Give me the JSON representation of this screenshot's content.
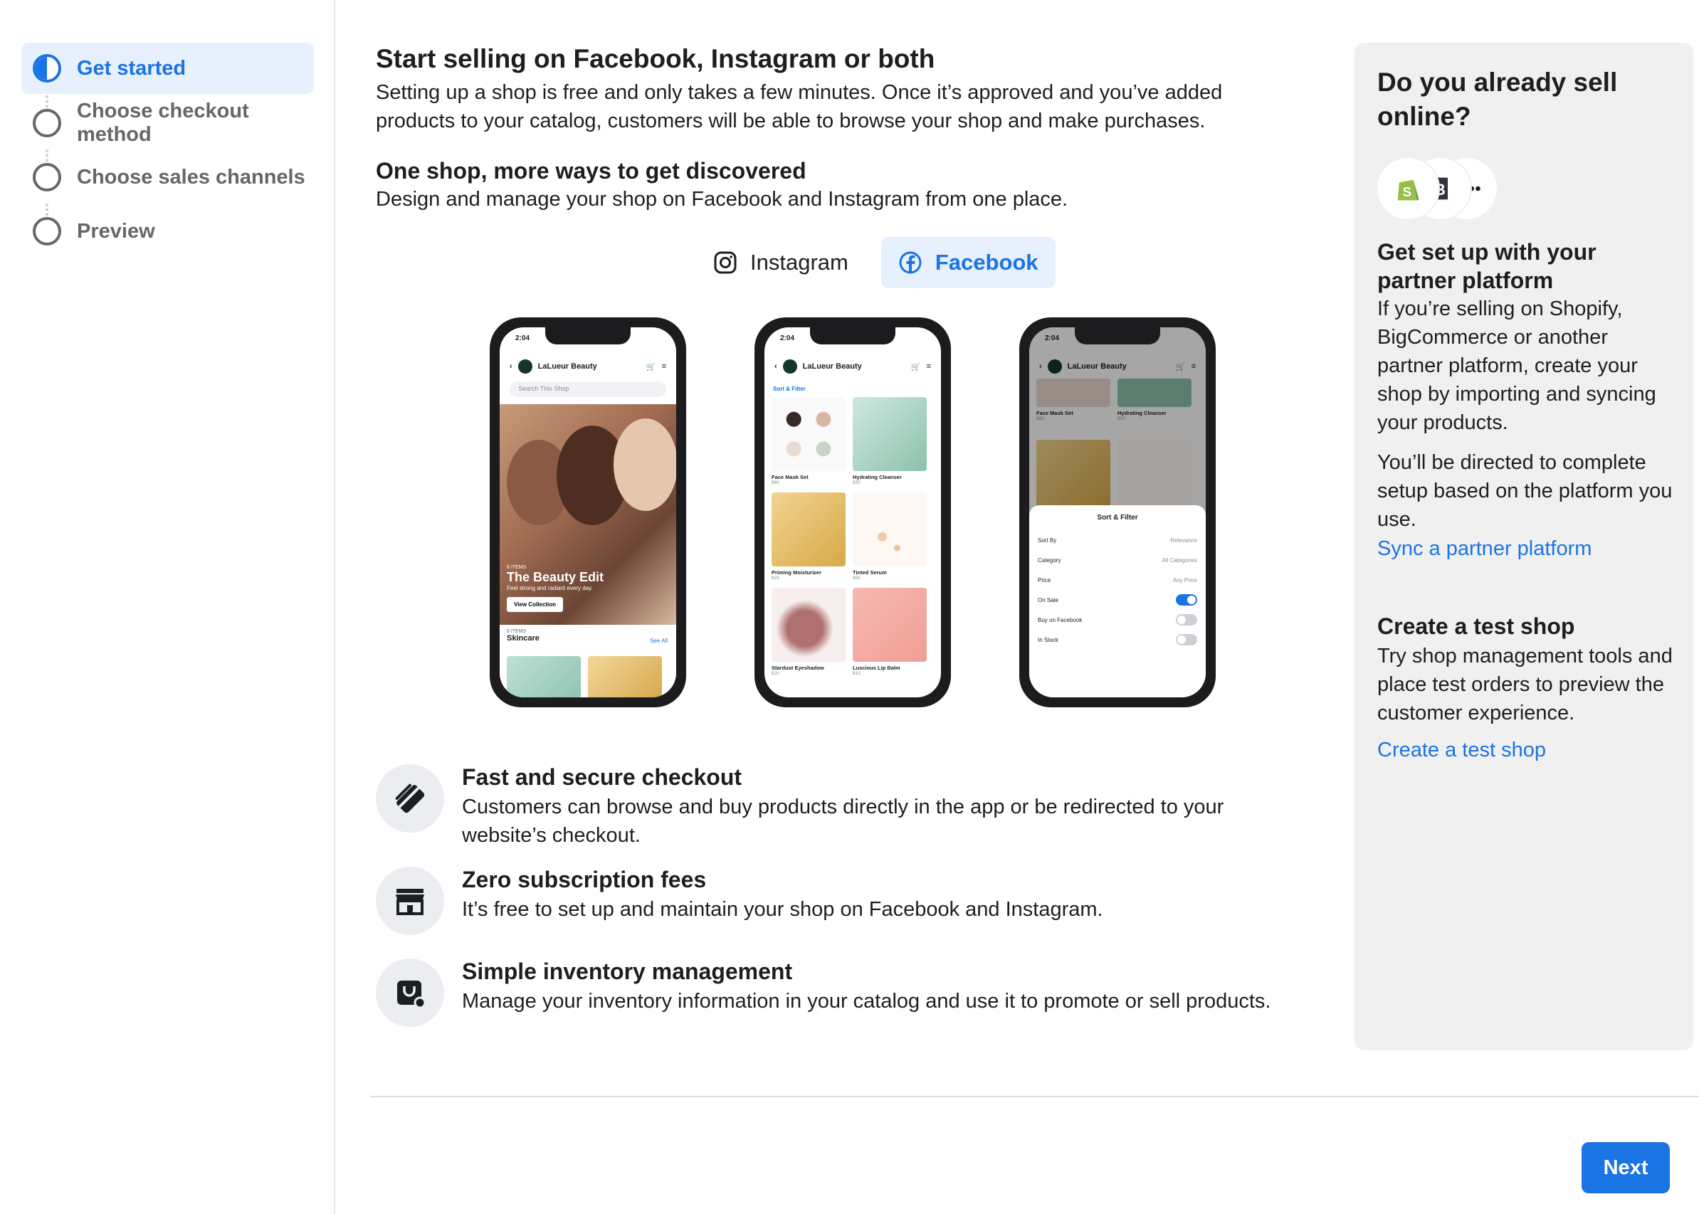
{
  "sidebar": {
    "steps": [
      {
        "label": "Get started",
        "active": true
      },
      {
        "label": "Choose checkout method",
        "active": false
      },
      {
        "label": "Choose sales channels",
        "active": false
      },
      {
        "label": "Preview",
        "active": false
      }
    ]
  },
  "main": {
    "title": "Start selling on Facebook, Instagram or both",
    "intro": "Setting up a shop is free and only takes a few minutes. Once it’s approved and you’ve added products to your catalog, customers will be able to browse your shop and make purchases.",
    "subtitle": "One shop, more ways to get discovered",
    "subtitle_desc": "Design and manage your shop on Facebook and Instagram from one place.",
    "tabs": [
      {
        "label": "Instagram",
        "icon": "instagram-icon",
        "selected": false
      },
      {
        "label": "Facebook",
        "icon": "facebook-icon",
        "selected": true
      }
    ],
    "features": [
      {
        "title": "Fast and secure checkout",
        "description": "Customers can browse and buy products directly in the app or be redirected to your website’s checkout.",
        "icon": "credit-card-icon"
      },
      {
        "title": "Zero subscription fees",
        "description": "It’s free to set up and maintain your shop on Facebook and Instagram.",
        "icon": "storefront-icon"
      },
      {
        "title": "Simple inventory management",
        "description": "Manage your inventory information in your catalog and use it to promote or sell products.",
        "icon": "shopping-bag-icon"
      }
    ]
  },
  "phones": {
    "time": "2:04",
    "shop_name": "LaLueur Beauty",
    "search_placeholder": "Search This Shop",
    "hero_kicker": "6 ITEMS",
    "hero_title": "The Beauty Edit",
    "hero_sub": "Feel strong and radiant every day.",
    "hero_button": "View Collection",
    "collection_kicker": "6 ITEMS",
    "collection_title": "Skincare",
    "see_all": "See All",
    "sort_filter_link": "Sort & Filter",
    "products": [
      {
        "name": "Face Mask Set",
        "price": "$60"
      },
      {
        "name": "Hydrating Cleanser",
        "price": "$20"
      },
      {
        "name": "Priming Moisturizer",
        "price": "$25"
      },
      {
        "name": "Tinted Serum",
        "price": "$55"
      },
      {
        "name": "Stardust Eyeshadow",
        "price": "$20"
      },
      {
        "name": "Luscious Lip Balm",
        "price": "$15"
      }
    ],
    "sheet_title": "Sort & Filter",
    "sheet_rows": [
      {
        "label": "Sort By",
        "value": "Relevance"
      },
      {
        "label": "Category",
        "value": "All Categories"
      },
      {
        "label": "Price",
        "value": "Any Price"
      }
    ],
    "sheet_toggles": [
      {
        "label": "On Sale",
        "on": true
      },
      {
        "label": "Buy on Facebook",
        "on": false
      },
      {
        "label": "In Stock",
        "on": false
      }
    ]
  },
  "right_panel": {
    "title": "Do you already sell online?",
    "partner_logos": [
      "shopify-logo-icon",
      "bigcommerce-logo-icon",
      "more-partners-icon"
    ],
    "partner_heading": "Get set up with your partner platform",
    "partner_desc": "If you’re selling on Shopify, BigCommerce or another partner platform, create your shop by importing and syncing your products.",
    "partner_note": "You’ll be directed to complete setup based on the platform you use.",
    "partner_link": "Sync a partner platform",
    "test_heading": "Create a test shop",
    "test_desc": "Try shop management tools and place test orders to preview the customer experience.",
    "test_link": "Create a test shop"
  },
  "footer": {
    "next_label": "Next"
  },
  "colors": {
    "accent": "#1b74e4",
    "active_bg": "#e7f0fd",
    "panel_bg": "#f0f0f0",
    "muted_text": "#65676b"
  }
}
